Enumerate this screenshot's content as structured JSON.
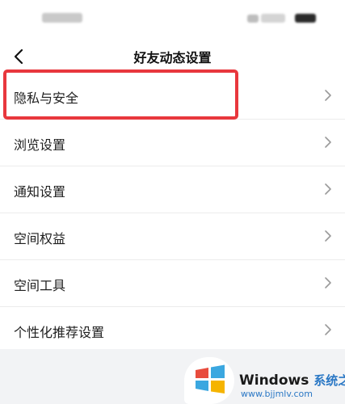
{
  "nav": {
    "title": "好友动态设置",
    "back_icon": "chevron-left-icon"
  },
  "menu": {
    "items": [
      {
        "label": "隐私与安全",
        "highlighted": true
      },
      {
        "label": "浏览设置"
      },
      {
        "label": "通知设置"
      },
      {
        "label": "空间权益"
      },
      {
        "label": "空间工具"
      },
      {
        "label": "个性化推荐设置"
      }
    ],
    "chevron_icon": "chevron-right-icon"
  },
  "colors": {
    "highlight": "#e8373d",
    "background": "#f2f3f5",
    "watermark_blue": "#2b78c5"
  },
  "watermark": {
    "brand": "Windows",
    "site_name": "系统之家",
    "url": "www.bjjmlv.com"
  }
}
